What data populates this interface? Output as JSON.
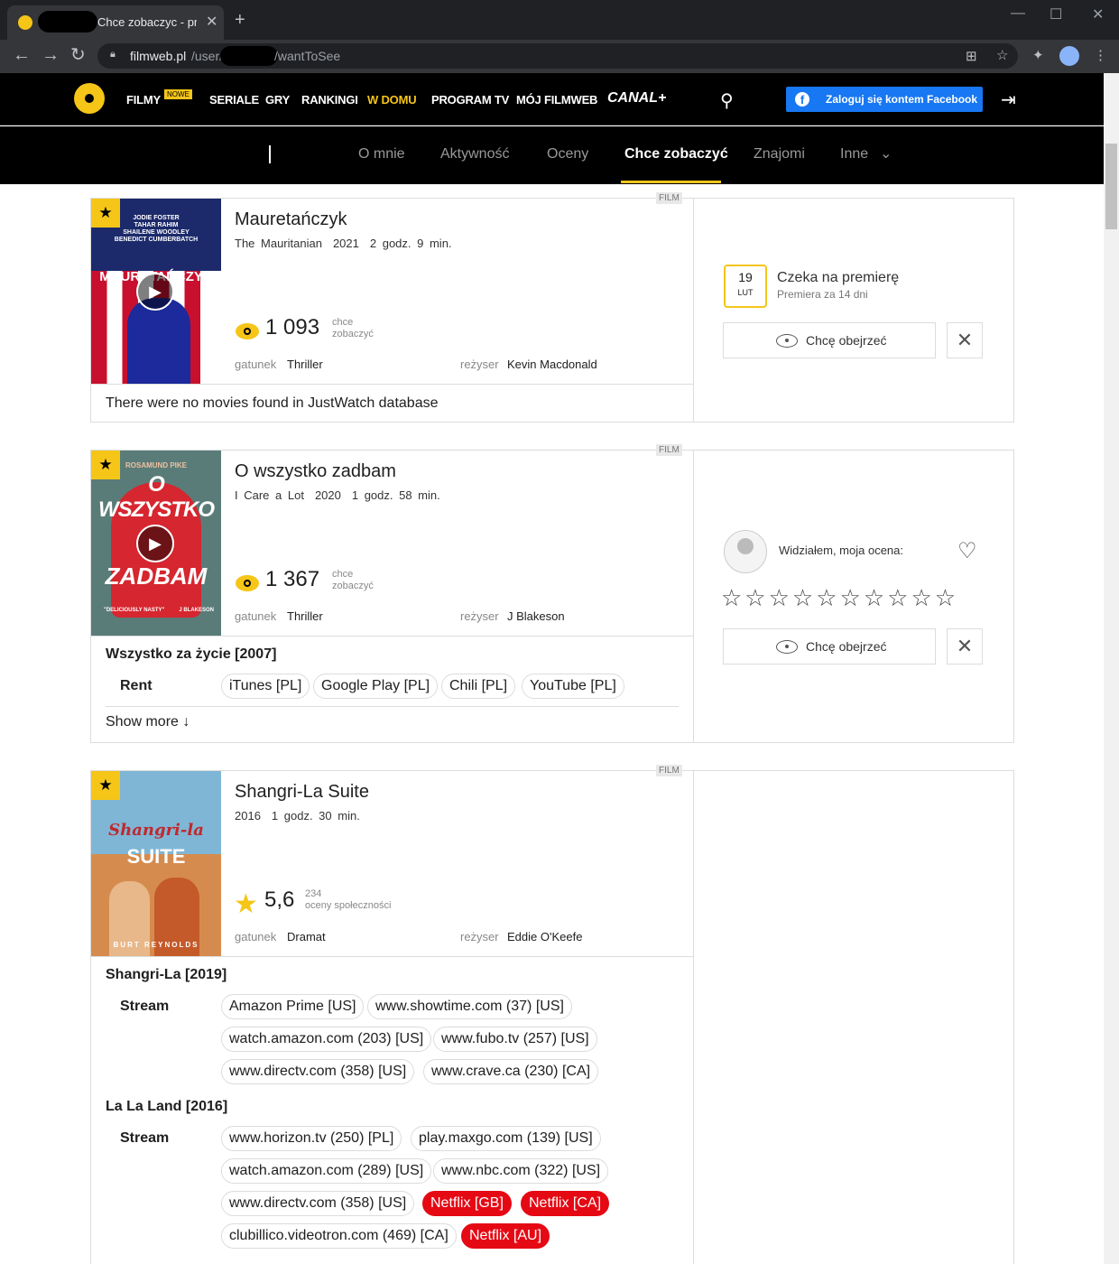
{
  "browser": {
    "tab_title": "Chce zobaczyc - prof",
    "tab_close": "✕",
    "new_tab": "+",
    "url_host": "filmweb.pl",
    "url_part1": "/user/",
    "url_part2": "/wantToSee"
  },
  "nav": {
    "menu": [
      "FILMY",
      "SERIALE",
      "GRY",
      "RANKINGI",
      "W DOMU",
      "PROGRAM TV",
      "MÓJ FILMWEB"
    ],
    "badge_new": "NOWE",
    "canal": "CANAL+",
    "fb_label": "Zaloguj się kontem Facebook",
    "accent_color": "#f5c518"
  },
  "tabs": [
    "O mnie",
    "Aktywność",
    "Oceny",
    "Chce zobaczyć",
    "Znajomi",
    "Inne"
  ],
  "labels": {
    "film_tag": "FILM",
    "want_count_line1": "chce",
    "want_count_line2": "zobaczyć",
    "genre": "gatunek",
    "director": "reżyser",
    "want_btn": "Chcę obejrzeć",
    "show_more": "Show more ↓",
    "seen_rating": "Widziałem, moja ocena:",
    "waits": "Czeka na premierę"
  },
  "films": [
    {
      "title": "Mauretańczyk",
      "original_title": "The Mauritanian",
      "year": "2021",
      "duration": "2 godz. 9 min.",
      "want_count": "1 093",
      "genre": "Thriller",
      "director": "Kevin Macdonald",
      "no_jw": "There were no movies found in JustWatch database",
      "premiere_day": "19",
      "premiere_month": "LUT",
      "premiere_in": "Premiera za 14 dni",
      "poster_title": "MAURETAŃCZYK",
      "poster_cast": [
        "JODIE FOSTER",
        "TAHAR RAHIM",
        "SHAILENE WOODLEY",
        "BENEDICT CUMBERBATCH"
      ]
    },
    {
      "title": "O wszystko zadbam",
      "original_title": "I Care a Lot",
      "year": "2020",
      "duration": "1 godz. 58 min.",
      "want_count": "1 367",
      "genre": "Thriller",
      "director": "J Blakeson",
      "jw_title": "Wszystko za życie [2007]",
      "jw_type": "Rent",
      "providers": [
        "iTunes [PL]",
        "Google Play [PL]",
        "Chili [PL]",
        "YouTube [PL]"
      ],
      "poster_top": "ROSAMUND PIKE",
      "poster_l1": "O WSZYSTKO",
      "poster_l2": "ZADBAM",
      "poster_quote": "\"DELICIOUSLY NASTY\"",
      "poster_dir": "J BLAKESON"
    },
    {
      "title": "Shangri-La Suite",
      "year": "2016",
      "duration": "1 godz. 30 min.",
      "rating": "5,6",
      "rating_count": "234",
      "rating_label": "oceny społeczności",
      "genre": "Dramat",
      "director": "Eddie O'Keefe",
      "poster_l1": "Shangri-la",
      "poster_l2": "SUITE",
      "poster_bottom": "BURT REYNOLDS",
      "groups": [
        {
          "title": "Shangri-La [2019]",
          "type": "Stream",
          "providers": [
            "Amazon Prime [US]",
            "www.showtime.com (37) [US]",
            "watch.amazon.com (203) [US]",
            "www.fubo.tv (257) [US]",
            "www.directv.com (358) [US]",
            "www.crave.ca (230) [CA]"
          ]
        },
        {
          "title": "La La Land [2016]",
          "type": "Stream",
          "providers": [
            "www.horizon.tv (250) [PL]",
            "play.maxgo.com (139) [US]",
            "watch.amazon.com (289) [US]",
            "www.nbc.com (322) [US]",
            "www.directv.com (358) [US]",
            "Netflix [GB]",
            "Netflix [CA]",
            "clubillico.videotron.com (469) [CA]",
            "Netflix [AU]"
          ]
        }
      ]
    }
  ]
}
